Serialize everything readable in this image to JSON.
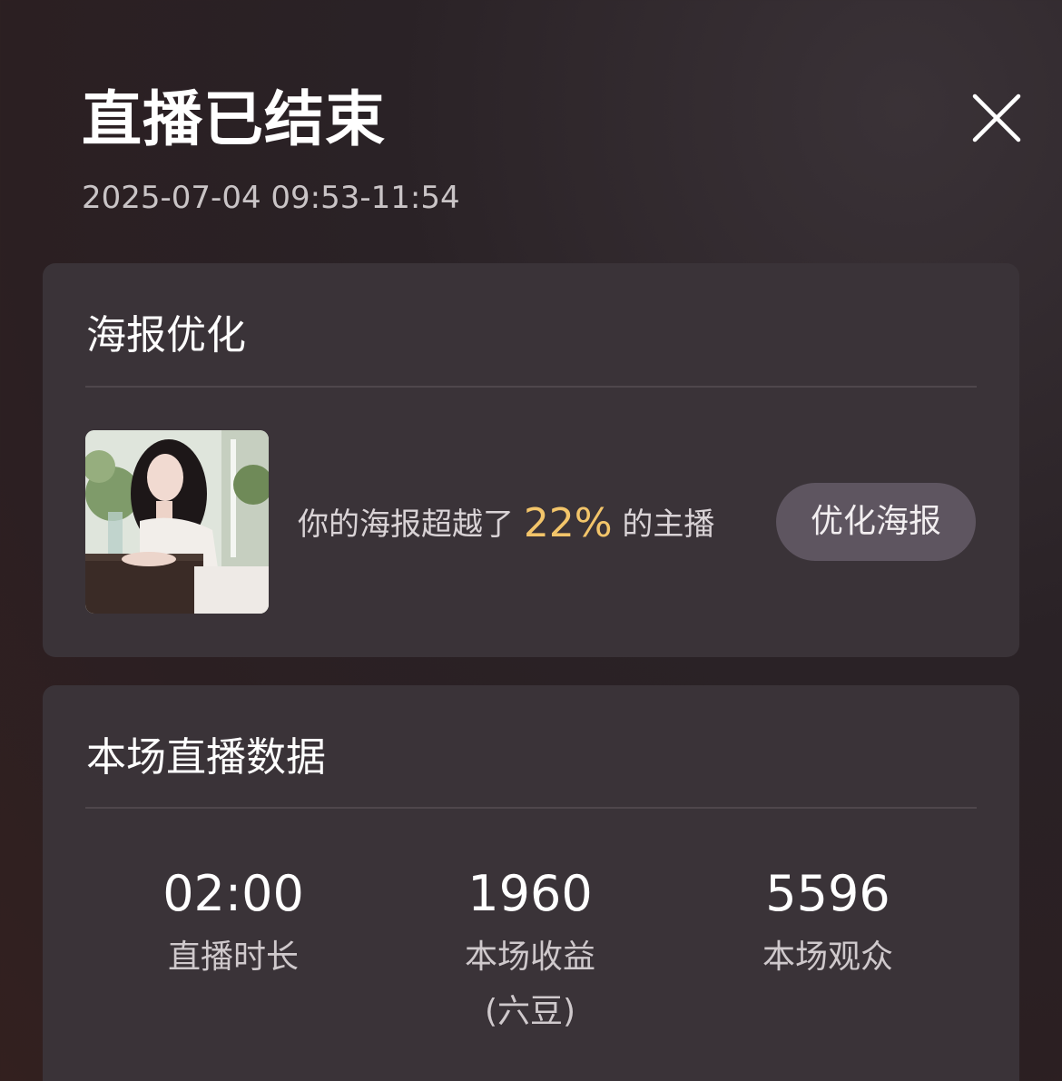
{
  "header": {
    "title": "直播已结束",
    "time_range": "2025-07-04 09:53-11:54"
  },
  "poster_card": {
    "title": "海报优化",
    "text_prefix": "你的海报超越了",
    "percent": "22%",
    "text_suffix": "的主播",
    "button_label": "优化海报"
  },
  "stats_card": {
    "title": "本场直播数据",
    "stats": [
      {
        "value": "02:00",
        "label": "直播时长",
        "sublabel": ""
      },
      {
        "value": "1960",
        "label": "本场收益",
        "sublabel": "(六豆)"
      },
      {
        "value": "5596",
        "label": "本场观众",
        "sublabel": ""
      }
    ]
  },
  "colors": {
    "accent": "#f3c56a",
    "card_bg": "#3a3338",
    "button_bg": "#5e5560"
  },
  "icons": {
    "close": "close-icon"
  }
}
